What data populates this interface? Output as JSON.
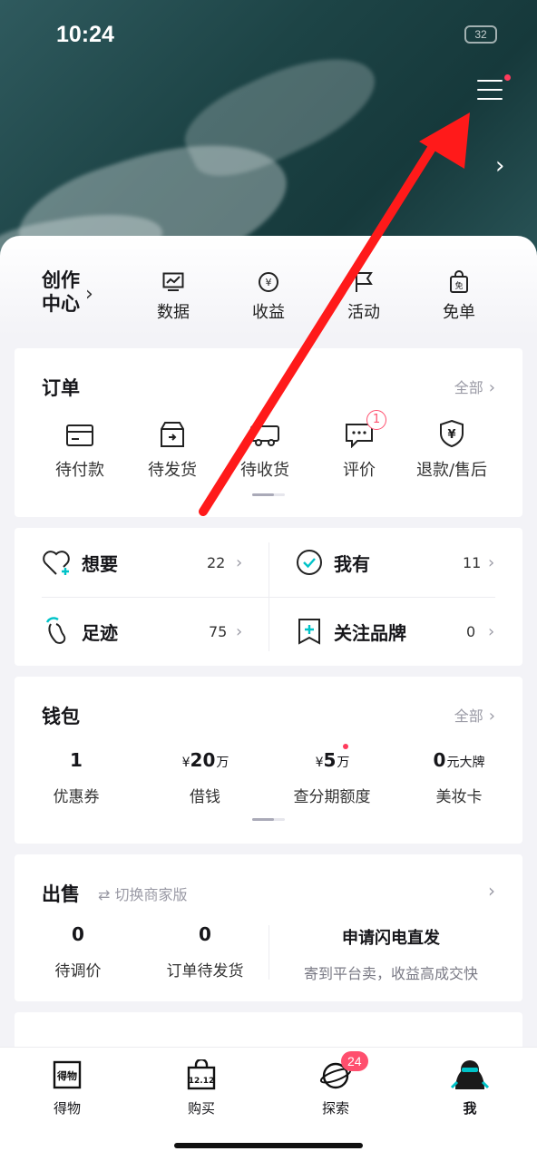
{
  "status_bar": {
    "time": "10:24",
    "battery": "32"
  },
  "header": {
    "menu_icon": "hamburger-menu-icon"
  },
  "creator": {
    "title_line1": "创作",
    "title_line2": "中心",
    "items": [
      {
        "label": "数据",
        "icon": "chart-icon"
      },
      {
        "label": "收益",
        "icon": "coin-icon"
      },
      {
        "label": "活动",
        "icon": "flag-icon"
      },
      {
        "label": "免单",
        "icon": "bag-icon"
      }
    ]
  },
  "orders": {
    "title": "订单",
    "more": "全部",
    "items": [
      {
        "label": "待付款",
        "icon": "card-icon"
      },
      {
        "label": "待发货",
        "icon": "box-icon"
      },
      {
        "label": "待收货",
        "icon": "truck-icon"
      },
      {
        "label": "评价",
        "icon": "comment-icon",
        "badge": "1"
      },
      {
        "label": "退款/售后",
        "icon": "refund-shield-icon"
      }
    ]
  },
  "collections": {
    "items": [
      {
        "name": "想要",
        "count": "22",
        "icon": "heart-plus-icon"
      },
      {
        "name": "我有",
        "count": "11",
        "icon": "check-circle-icon"
      },
      {
        "name": "足迹",
        "count": "75",
        "icon": "footprint-icon"
      },
      {
        "name": "关注品牌",
        "count": "0",
        "icon": "bookmark-plus-icon"
      }
    ]
  },
  "wallet": {
    "title": "钱包",
    "more": "全部",
    "items": [
      {
        "prefix": "",
        "value": "1",
        "unit": "",
        "label": "优惠券"
      },
      {
        "prefix": "¥",
        "value": "20",
        "unit": "万",
        "label": "借钱"
      },
      {
        "prefix": "¥",
        "value": "5",
        "unit": "万",
        "label": "查分期额度"
      },
      {
        "prefix": "",
        "value": "0",
        "unit": "元大牌",
        "label": "美妆卡"
      }
    ]
  },
  "sell": {
    "title": "出售",
    "switch_label": "切换商家版",
    "items": [
      {
        "value": "0",
        "label": "待调价"
      },
      {
        "value": "0",
        "label": "订单待发货"
      }
    ],
    "promo_title": "申请闪电直发",
    "promo_sub": "寄到平台卖，收益高成交快"
  },
  "tabbar": {
    "tabs": [
      {
        "label": "得物",
        "icon": "dewu-logo-icon"
      },
      {
        "label": "购买",
        "icon": "shopping-bag-icon"
      },
      {
        "label": "探索",
        "icon": "planet-icon",
        "badge": "24"
      },
      {
        "label": "我",
        "icon": "avatar-icon"
      }
    ]
  },
  "colors": {
    "accent": "#00c3c8",
    "badge": "#ff4f6e",
    "arrow": "#ff1a1a",
    "hero": "#1d4446"
  }
}
